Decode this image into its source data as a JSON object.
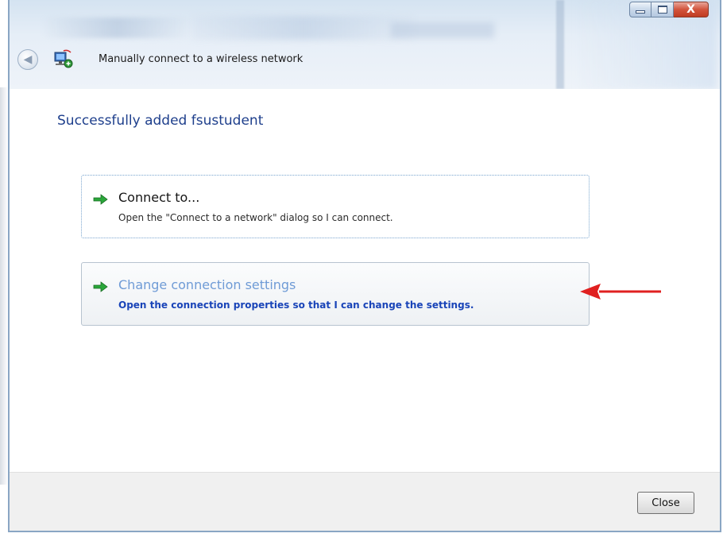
{
  "window": {
    "title": "Manually connect to a wireless network",
    "caption_buttons": {
      "close_glyph": "X"
    },
    "accent_color": "#1e3f8c"
  },
  "main": {
    "heading": "Successfully added fsustudent",
    "commands": [
      {
        "title": "Connect to...",
        "description": "Open the \"Connect to a network\" dialog so I can connect.",
        "icon": "green-arrow-icon"
      },
      {
        "title": "Change connection settings",
        "description": "Open the connection properties so that I can change the settings.",
        "icon": "green-arrow-icon",
        "hovered": true
      }
    ],
    "annotation": {
      "icon": "red-arrow-icon",
      "color": "#e02020"
    }
  },
  "footer": {
    "close_label": "Close"
  }
}
